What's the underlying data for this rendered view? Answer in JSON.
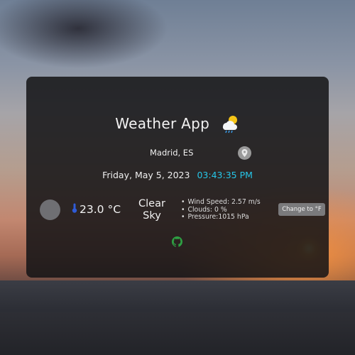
{
  "app": {
    "title": "Weather App"
  },
  "location": {
    "city": "Madrid, ES"
  },
  "datetime": {
    "date": "Friday, May 5, 2023",
    "time": "03:43:35 PM"
  },
  "current": {
    "temperature": "23.0 °C",
    "condition": "Clear Sky"
  },
  "details": {
    "wind": "Wind Speed: 2.57 m/s",
    "clouds": "Clouds: 0 %",
    "pressure": "Pressure:1015 hPa"
  },
  "controls": {
    "change_unit_label": "Change to °F"
  },
  "icons": {
    "title_icon": "cloud-sun-rain-icon",
    "location_icon": "map-pin-icon",
    "temp_icon": "thermometer-icon",
    "footer_icon": "github-icon"
  },
  "colors": {
    "time_accent": "#26c6e8",
    "github_green": "#2ea043",
    "button_bg": "#7a7a7c"
  }
}
